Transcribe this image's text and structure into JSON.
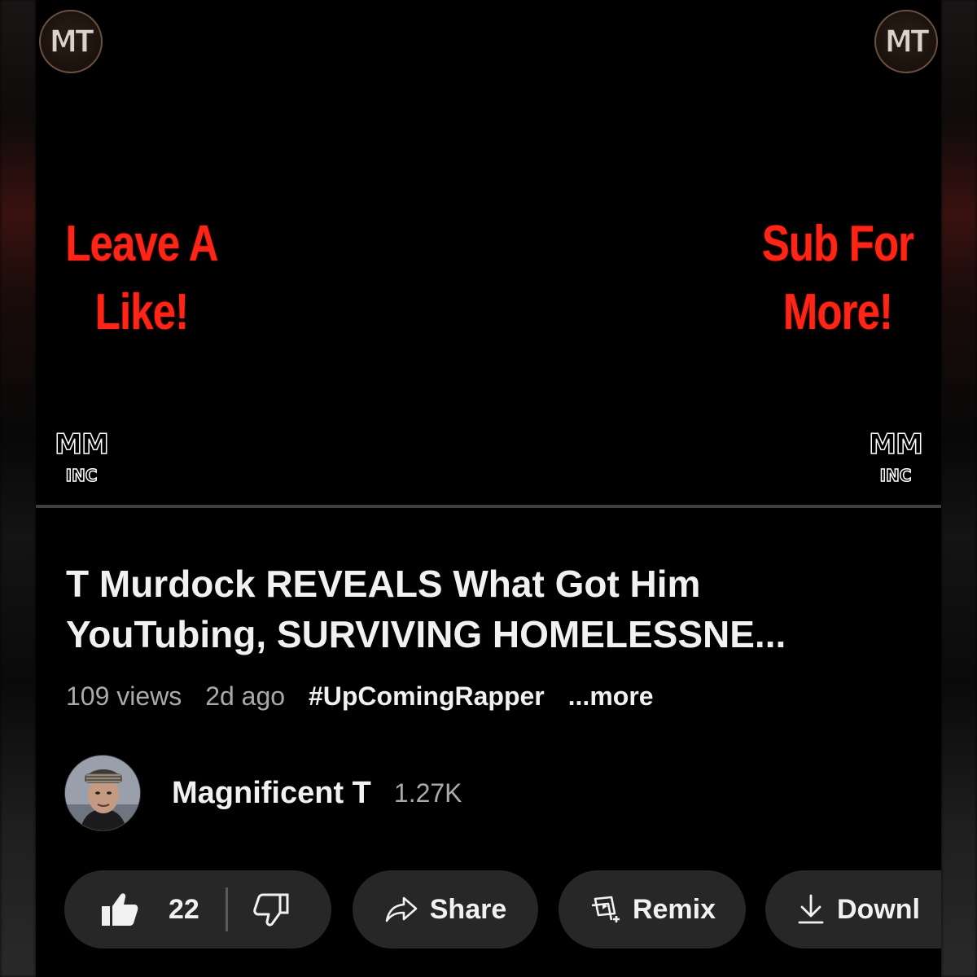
{
  "video": {
    "logo_text": "MT",
    "promo_left": [
      "Leave A",
      "Like!"
    ],
    "promo_right": [
      "Sub For",
      "More!"
    ],
    "watermark_big": "MM",
    "watermark_small": "INC"
  },
  "title_lines": [
    "T Murdock REVEALS What Got Him",
    "YouTubing, SURVIVING HOMELESSNE..."
  ],
  "meta": {
    "views": "109 views",
    "age": "2d ago",
    "hashtag": "#UpComingRapper",
    "more": "...more"
  },
  "channel": {
    "name": "Magnificent T",
    "subscribers": "1.27K"
  },
  "actions": {
    "like_count": "22",
    "share_label": "Share",
    "remix_label": "Remix",
    "download_label": "Downl"
  },
  "icons": {
    "like": "thumbs-up-icon",
    "dislike": "thumbs-down-icon",
    "share": "share-arrow-icon",
    "remix": "remix-icon",
    "download": "download-icon"
  },
  "colors": {
    "background": "#000000",
    "promo_red": "#ff2516",
    "pill_bg": "#272727",
    "text_primary": "#f1f1f1",
    "text_secondary": "#aaaaaa"
  }
}
